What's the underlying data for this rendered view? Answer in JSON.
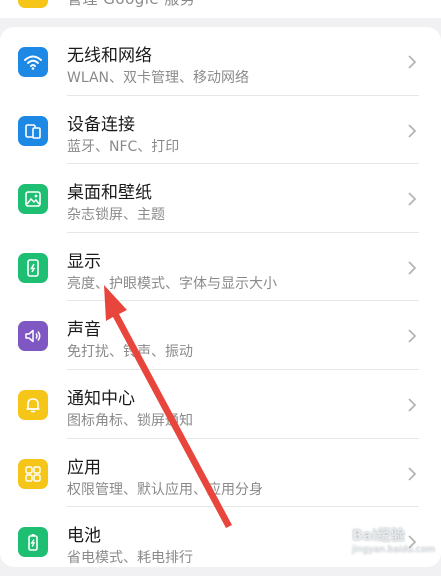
{
  "top": {
    "subtitle": "管理 Google 服务"
  },
  "items": [
    {
      "title": "无线和网络",
      "subtitle": "WLAN、双卡管理、移动网络",
      "icon": "wifi-icon",
      "color": "#1e88e5"
    },
    {
      "title": "设备连接",
      "subtitle": "蓝牙、NFC、打印",
      "icon": "device-connect-icon",
      "color": "#1e88e5"
    },
    {
      "title": "桌面和壁纸",
      "subtitle": "杂志锁屏、主题",
      "icon": "wallpaper-icon",
      "color": "#1fbf73"
    },
    {
      "title": "显示",
      "subtitle": "亮度、护眼模式、字体与显示大小",
      "icon": "display-icon",
      "color": "#1fbf73"
    },
    {
      "title": "声音",
      "subtitle": "免打扰、铃声、振动",
      "icon": "sound-icon",
      "color": "#7e57c2"
    },
    {
      "title": "通知中心",
      "subtitle": "图标角标、锁屏通知",
      "icon": "bell-icon",
      "color": "#f5c518"
    },
    {
      "title": "应用",
      "subtitle": "权限管理、默认应用、应用分身",
      "icon": "apps-icon",
      "color": "#f5c518"
    },
    {
      "title": "电池",
      "subtitle": "省电模式、耗电排行",
      "icon": "battery-icon",
      "color": "#1fbf73"
    }
  ],
  "annotation": {
    "arrow_color": "#e8453c"
  },
  "watermark": {
    "text": "Bai经验",
    "sub": "jingyan.baidu.com"
  }
}
